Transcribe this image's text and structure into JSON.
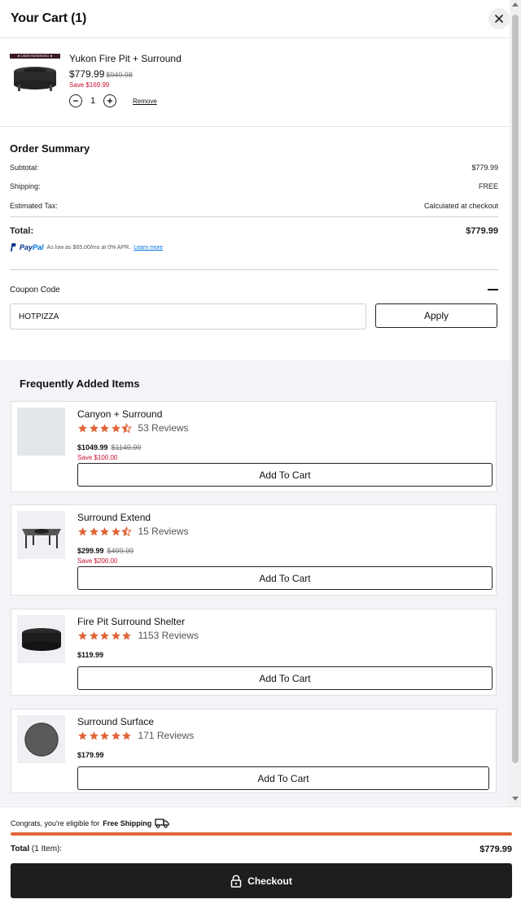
{
  "header": {
    "title": "Your Cart (1)"
  },
  "cart_item": {
    "badge": "★ USER RESERVED ★",
    "name": "Yukon Fire Pit + Surround",
    "price": "$779.99",
    "compare_price": "$949.98",
    "save": "Save $169.99",
    "quantity": "1",
    "remove_label": "Remove"
  },
  "summary": {
    "heading": "Order Summary",
    "subtotal_label": "Subtotal:",
    "subtotal_value": "$779.99",
    "shipping_label": "Shipping:",
    "shipping_value": "FREE",
    "tax_label": "Estimated Tax:",
    "tax_value": "Calculated at checkout",
    "total_label": "Total:",
    "total_value": "$779.99"
  },
  "paypal": {
    "logo_pay": "Pay",
    "logo_pal": "Pal",
    "text": "As low as $65.00/mo at 0% APR.",
    "learn_more": "Learn more"
  },
  "coupon": {
    "label": "Coupon Code",
    "value": "HOTPIZZA",
    "apply_label": "Apply"
  },
  "frequently_added": {
    "title": "Frequently Added Items",
    "items": [
      {
        "name": "Canyon + Surround",
        "rating": 4.5,
        "reviews": "53 Reviews",
        "price": "$1049.99",
        "compare_price": "$1149.99",
        "save": "Save $100.00",
        "button": "Add To Cart"
      },
      {
        "name": "Surround Extend",
        "rating": 4.5,
        "reviews": "15 Reviews",
        "price": "$299.99",
        "compare_price": "$499.99",
        "save": "Save $200.00",
        "button": "Add To Cart"
      },
      {
        "name": "Fire Pit Surround Shelter",
        "rating": 5,
        "reviews": "1153 Reviews",
        "price": "$119.99",
        "button": "Add To Cart"
      },
      {
        "name": "Surround Surface",
        "rating": 5,
        "reviews": "171 Reviews",
        "price": "$179.99",
        "button": "Add To Cart"
      }
    ]
  },
  "footer": {
    "ship_msg_prefix": "Congrats, you're eligible for",
    "ship_msg_bold": "Free Shipping",
    "progress": 1.0,
    "total_label_bold": "Total",
    "total_label_rest": " (1 Item):",
    "total_value": "$779.99",
    "checkout_label": "Checkout"
  },
  "colors": {
    "accent_orange": "#e0663a",
    "star": "#e0663a",
    "sale_red": "#c8102e",
    "checkout_bg": "#1e1e1e"
  }
}
